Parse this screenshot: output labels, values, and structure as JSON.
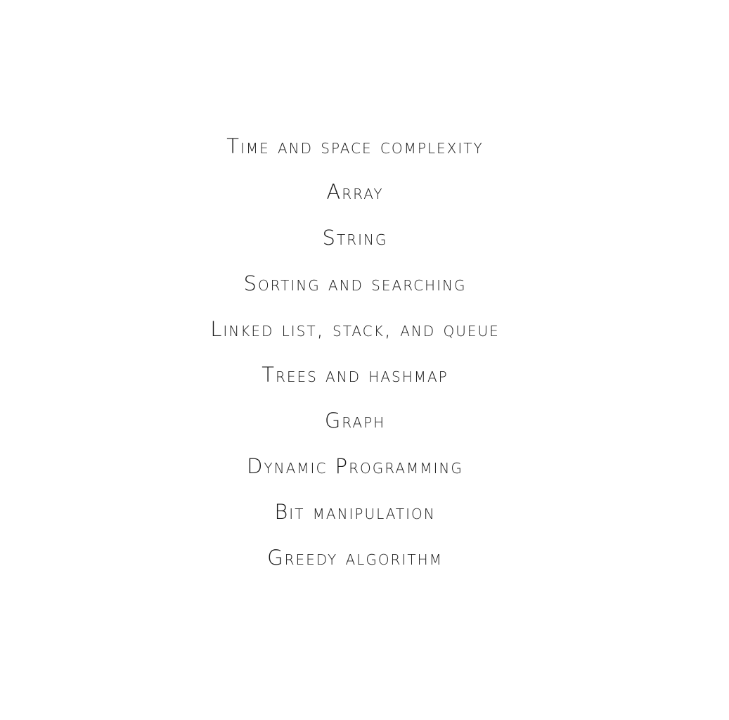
{
  "topics": [
    "Time and space complexity",
    "Array",
    "String",
    "Sorting and searching",
    "Linked list, stack, and queue",
    "Trees and hashmap",
    "Graph",
    "Dynamic Programming",
    "Bit manipulation",
    "Greedy algorithm"
  ]
}
